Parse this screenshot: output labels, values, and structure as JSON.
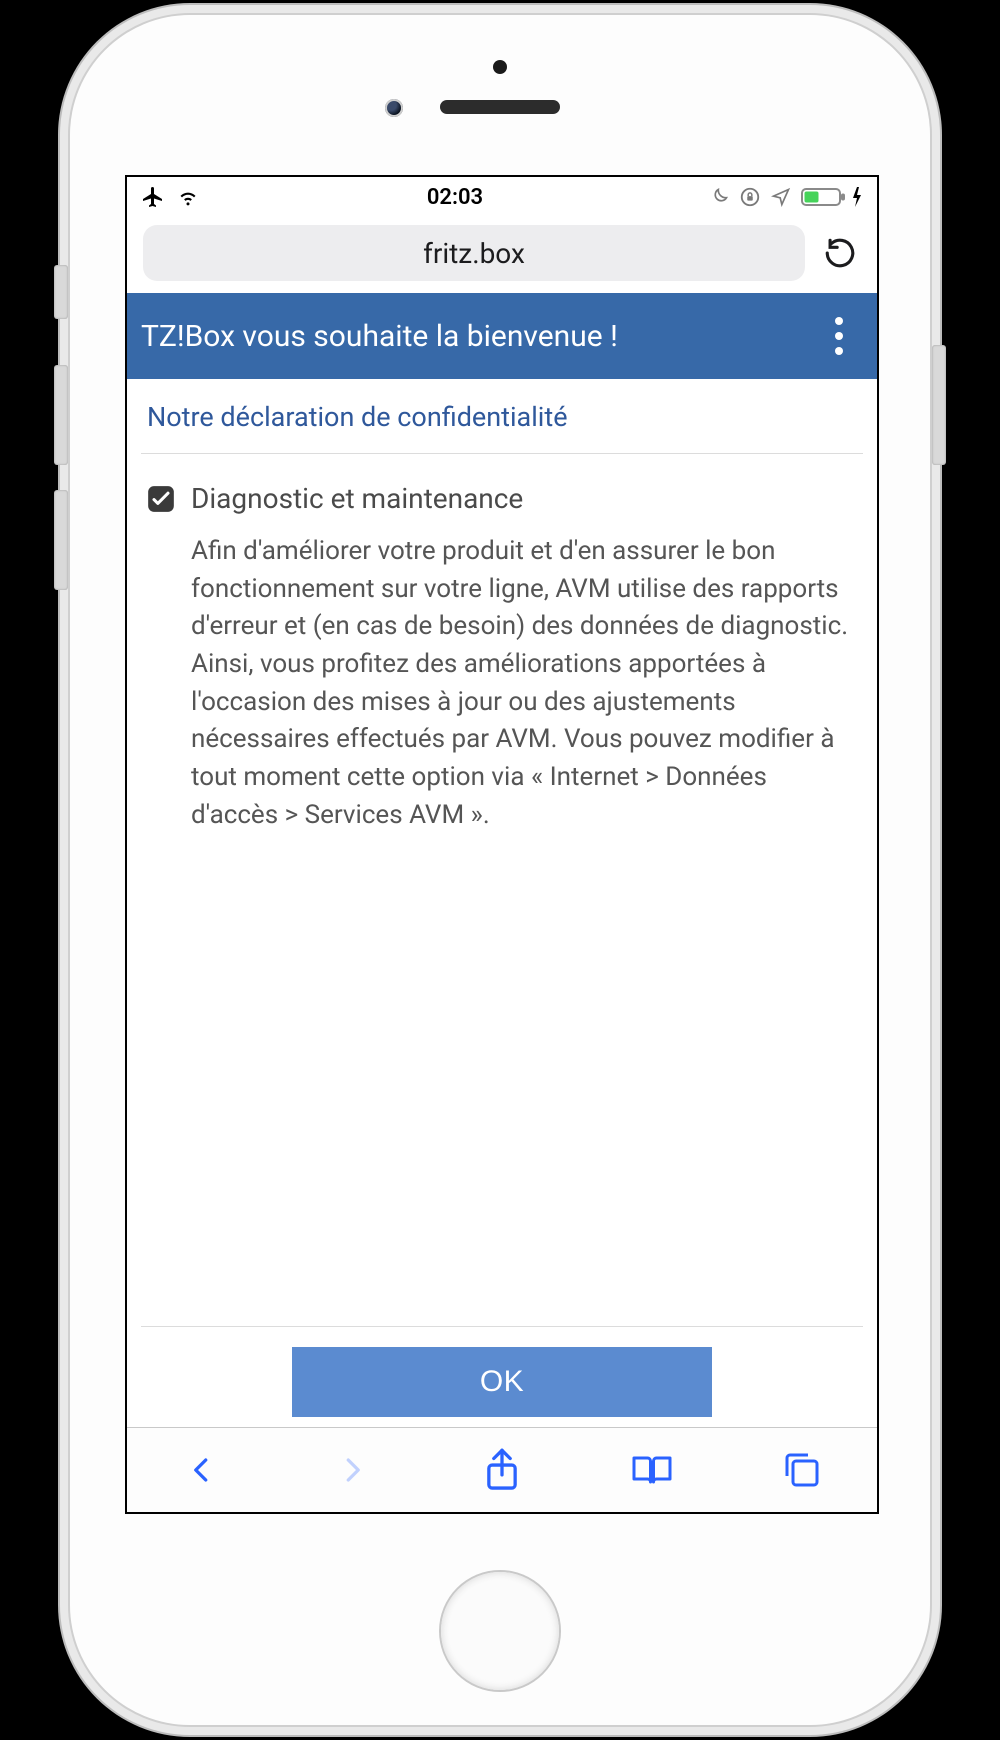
{
  "statusbar": {
    "time": "02:03",
    "left_icons": [
      "airplane-mode",
      "wifi"
    ],
    "right_icons": [
      "moon",
      "orientation-lock",
      "location",
      "battery-charging"
    ]
  },
  "browser": {
    "address": "fritz.box"
  },
  "app": {
    "header_title": "TZ!Box vous souhaite la bienvenue !",
    "privacy_link": "Notre déclaration de confidentialité",
    "diag_checked": true,
    "diag_title": "Diagnostic et maintenance",
    "diag_body": "Afin d'améliorer votre produit et d'en assurer le bon fonctionnement sur votre ligne, AVM utilise des rapports d'erreur et (en cas de besoin) des données de diagnostic. Ainsi, vous profitez des améliorations apportées à l'occasion des mises à jour ou des ajustements nécessaires effectués par AVM. Vous pouvez modifier à tout moment cette option via « Internet > Données d'accès > Services AVM ».",
    "ok_label": "OK"
  },
  "toolbar": {
    "back_enabled": true,
    "forward_enabled": false
  },
  "colors": {
    "header_bg": "#3769a8",
    "ok_bg": "#5b8bd0",
    "link": "#2f589b",
    "ios_blue": "#2a62ff"
  }
}
